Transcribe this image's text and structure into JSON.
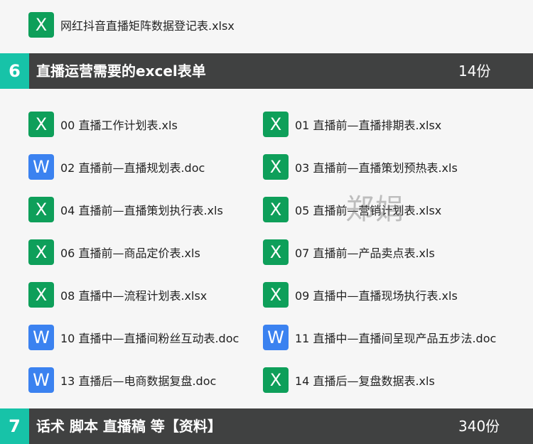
{
  "prev_item": {
    "icon": "X",
    "type": "excel",
    "name": "网红抖音直播矩阵数据登记表.xlsx"
  },
  "section6": {
    "number": "6",
    "title": "直播运营需要的excel表单",
    "count": "14份"
  },
  "files": [
    {
      "icon": "X",
      "type": "excel",
      "name": "00 直播工作计划表.xls"
    },
    {
      "icon": "X",
      "type": "excel",
      "name": "01 直播前—直播排期表.xlsx"
    },
    {
      "icon": "W",
      "type": "word",
      "name": "02 直播前—直播规划表.doc"
    },
    {
      "icon": "X",
      "type": "excel",
      "name": "03 直播前—直播策划预热表.xls"
    },
    {
      "icon": "X",
      "type": "excel",
      "name": "04 直播前—直播策划执行表.xls"
    },
    {
      "icon": "X",
      "type": "excel",
      "name": "05 直播前—营销计划表.xlsx"
    },
    {
      "icon": "X",
      "type": "excel",
      "name": "06 直播前—商品定价表.xls"
    },
    {
      "icon": "X",
      "type": "excel",
      "name": "07 直播前—产品卖点表.xls"
    },
    {
      "icon": "X",
      "type": "excel",
      "name": "08 直播中—流程计划表.xlsx"
    },
    {
      "icon": "X",
      "type": "excel",
      "name": "09 直播中—直播现场执行表.xls"
    },
    {
      "icon": "W",
      "type": "word",
      "name": "10 直播中—直播间粉丝互动表.doc"
    },
    {
      "icon": "W",
      "type": "word",
      "name": "11 直播中—直播间呈现产品五步法.doc"
    },
    {
      "icon": "W",
      "type": "word",
      "name": "13 直播后—电商数据复盘.doc"
    },
    {
      "icon": "X",
      "type": "excel",
      "name": "14 直播后—复盘数据表.xls"
    }
  ],
  "section7": {
    "number": "7",
    "title": "话术 脚本 直播稿 等【资料】",
    "count": "340份"
  },
  "watermark": "郑娟",
  "colors": {
    "excel": "#0e9f5a",
    "word": "#3b82f0",
    "header_bg": "#404141",
    "number_bg": "#17c3a8",
    "page_bg": "#f6f6f6"
  }
}
